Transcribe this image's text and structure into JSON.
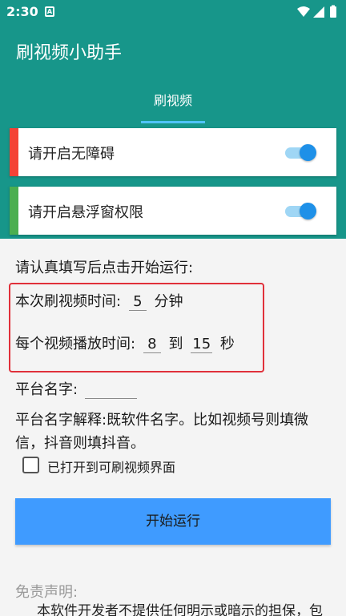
{
  "status_bar": {
    "time": "2:30",
    "notification_icon": "A"
  },
  "app": {
    "title": "刷视频小助手"
  },
  "tabs": [
    {
      "label": "刷视频",
      "active": true
    }
  ],
  "colors": {
    "primary": "#17968a",
    "accent": "#4fc3f7",
    "button": "#3f9bff",
    "card_red": "#f44336",
    "card_green": "#4caf50",
    "highlight_box": "#e0303a"
  },
  "cards": [
    {
      "label": "请开启无障碍",
      "bar_color": "#f44336",
      "switch_on": true
    },
    {
      "label": "请开启悬浮窗权限",
      "bar_color": "#4caf50",
      "switch_on": true
    }
  ],
  "form": {
    "instruction": "请认真填写后点击开始运行:",
    "duration": {
      "label": "本次刷视频时间:",
      "value": "5",
      "unit": "分钟"
    },
    "play_time": {
      "label": "每个视频播放时间:",
      "min": "8",
      "to": "到",
      "max": "15",
      "unit": "秒"
    },
    "platform": {
      "label": "平台名字:",
      "value": ""
    },
    "platform_hint_line1": "平台名字解释:既软件名字。比如视频号则填微",
    "platform_hint_line2": "信，抖音则填抖音。",
    "checkbox_label": "已打开到可刷视频界面",
    "checkbox_checked": false,
    "start_button": "开始运行"
  },
  "disclaimer": {
    "title": "免责声明:",
    "body": "本软件开发者不提供任何明示或暗示的担保，包"
  }
}
